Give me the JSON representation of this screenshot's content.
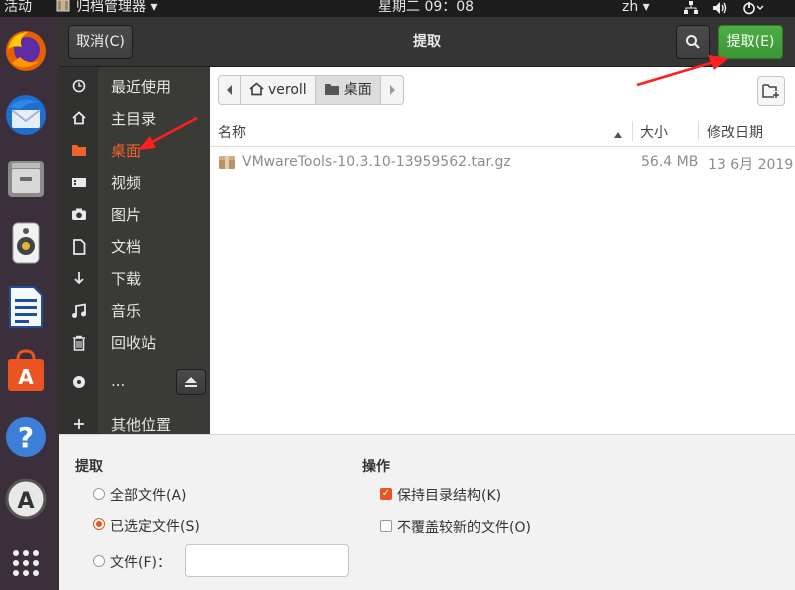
{
  "topbar": {
    "activities": "活动",
    "app_menu": "归档管理器 ▾",
    "clock": "星期二 09：08",
    "input_method": "zh ▾",
    "system_icons": [
      "network-icon",
      "volume-icon",
      "power-icon"
    ]
  },
  "dock": {
    "apps": [
      "firefox-icon",
      "thunderbird-icon",
      "files-icon",
      "rhythmbox-icon",
      "libreoffice-writer-icon",
      "software-center-icon",
      "help-icon",
      "software-updater-icon",
      "show-apps-icon"
    ]
  },
  "header": {
    "cancel_label": "取消(C)",
    "title": "提取",
    "search_icon": "search-icon",
    "extract_label": "提取(E)"
  },
  "sidebar": {
    "items": [
      {
        "label": "最近使用",
        "icon": "clock-icon"
      },
      {
        "label": "主目录",
        "icon": "home-icon"
      },
      {
        "label": "桌面",
        "icon": "folder-icon"
      },
      {
        "label": "视频",
        "icon": "video-icon"
      },
      {
        "label": "图片",
        "icon": "camera-icon"
      },
      {
        "label": "文档",
        "icon": "document-icon"
      },
      {
        "label": "下载",
        "icon": "download-icon"
      },
      {
        "label": "音乐",
        "icon": "music-icon"
      },
      {
        "label": "回收站",
        "icon": "trash-icon"
      },
      {
        "label": "...",
        "icon": "disc-icon"
      },
      {
        "label": "其他位置",
        "icon": "plus-icon"
      }
    ],
    "active_index": 2
  },
  "pathbar": {
    "segments": [
      "veroll",
      "桌面"
    ]
  },
  "columns": {
    "name": "名称",
    "size": "大小",
    "modified": "修改日期"
  },
  "files": [
    {
      "name": "VMwareTools-10.3.10-13959562.tar.gz",
      "size": "56.4 MB",
      "modified": "13 6月 2019"
    }
  ],
  "options": {
    "extract_title": "提取",
    "all_files": "全部文件(A)",
    "selected_files": "已选定文件(S)",
    "files_label": "文件(F)：",
    "files_value": "",
    "selected_radio": "selected_files",
    "actions_title": "操作",
    "keep_structure": "保持目录结构(K)",
    "keep_structure_checked": true,
    "no_overwrite": "不覆盖较新的文件(O)",
    "no_overwrite_checked": false
  },
  "colors": {
    "accent": "#e95420",
    "extract_button": "#3fae3c",
    "annotation_arrow": "#ff1f1f"
  }
}
